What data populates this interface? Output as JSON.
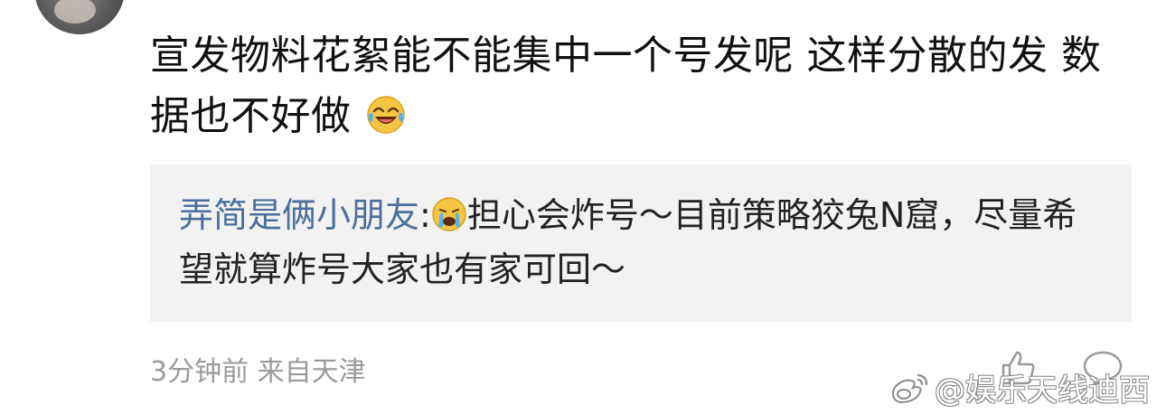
{
  "comment": {
    "text": "宣发物料花絮能不能集中一个号发呢 这样分散的发 数据也不好做",
    "emoji_icon": "crying-laughing-emoji"
  },
  "quote": {
    "author": "弄简是俩小朋友",
    "separator": ":",
    "emoji_icon": "crying-emoji",
    "text": "担心会炸号～目前策略狡兔N窟，尽量希望就算炸号大家也有家可回～"
  },
  "meta": {
    "time": "3分钟前",
    "source": "来自天津"
  },
  "actions": {
    "like_icon": "thumbs-up-icon",
    "reply_icon": "comment-bubble-icon"
  },
  "watermark": {
    "text": "@娱乐天线迪西",
    "logo_icon": "weibo-logo-icon"
  },
  "colors": {
    "author_link": "#4a6f9c",
    "quote_bg": "#f2f2f2",
    "meta_text": "#9a9a9a",
    "body_text": "#111111"
  }
}
